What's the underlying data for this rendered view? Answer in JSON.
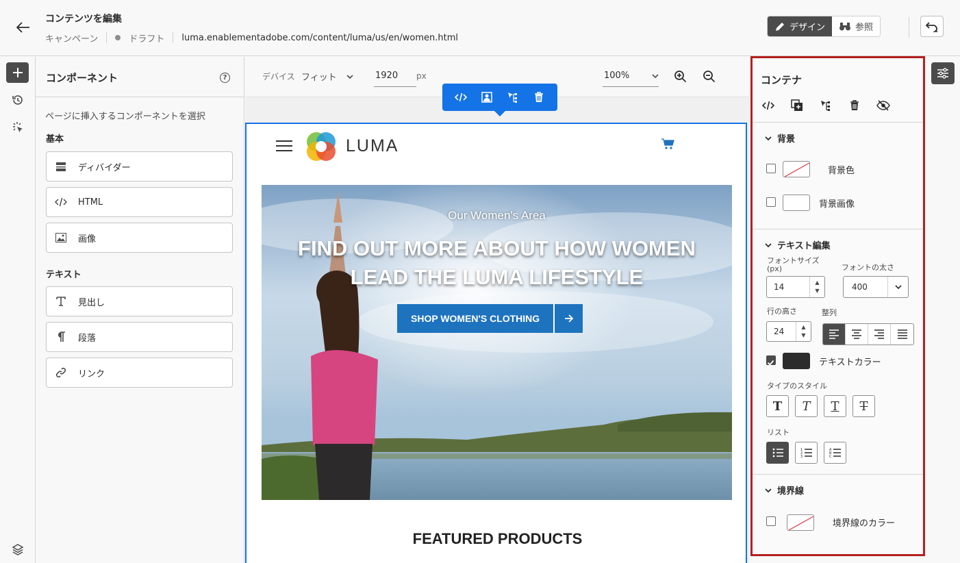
{
  "header": {
    "title": "コンテンツを編集",
    "crumb_campaign": "キャンペーン",
    "crumb_status": "ドラフト",
    "url": "luma.enablementadobe.com/content/luma/us/en/women.html",
    "design_label": "デザイン",
    "browse_label": "参照"
  },
  "components": {
    "title": "コンポーネント",
    "description": "ページに挿入するコンポーネントを選択",
    "basic_label": "基本",
    "text_label": "テキスト",
    "basic_items": [
      "ディバイダー",
      "HTML",
      "画像"
    ],
    "text_items": [
      "見出し",
      "段落",
      "リンク"
    ]
  },
  "canvas": {
    "device_label": "デバイス",
    "device_value": "フィット",
    "width_value": "1920",
    "width_unit": "px",
    "zoom_value": "100%"
  },
  "page": {
    "logo_text": "LUMA",
    "hero_subtitle": "Our Women's Area",
    "hero_title_line1": "FIND OUT MORE ABOUT HOW WOMEN",
    "hero_title_line2": "LEAD THE LUMA LIFESTYLE",
    "hero_cta": "SHOP WOMEN'S CLOTHING",
    "featured": "FEATURED PRODUCTS"
  },
  "props": {
    "title": "コンテナ",
    "background_section": "背景",
    "bg_color_label": "背景色",
    "bg_image_label": "背景画像",
    "text_section": "テキスト編集",
    "font_size_label": "フォントサイズ (px)",
    "font_size_value": "14",
    "font_weight_label": "フォントの太さ",
    "font_weight_value": "400",
    "line_height_label": "行の高さ",
    "line_height_value": "24",
    "align_label": "整列",
    "text_color_label": "テキストカラー",
    "type_style_label": "タイプのスタイル",
    "list_label": "リスト",
    "border_section": "境界線",
    "border_color_label": "境界線のカラー"
  },
  "colors": {
    "accent": "#1473e6",
    "highlight_border": "#b41f1f",
    "cta_blue": "#1e73be",
    "text_color_swatch": "#2c2c2c"
  }
}
